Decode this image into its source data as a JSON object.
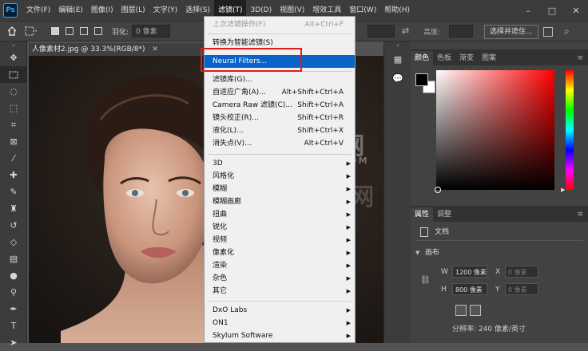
{
  "app": {
    "logo": "Ps"
  },
  "menubar": {
    "items": [
      "文件(F)",
      "编辑(E)",
      "图像(I)",
      "图层(L)",
      "文字(Y)",
      "选择(S)",
      "滤镜(T)",
      "3D(D)",
      "视图(V)",
      "增效工具",
      "窗口(W)",
      "帮助(H)"
    ],
    "active_index": 6,
    "controls": {
      "minimize": "–",
      "maximize": "□",
      "close": "✕"
    }
  },
  "options_bar": {
    "feather_label": "羽化:",
    "feather_value": "0 像素",
    "height_label": "高度:",
    "select_mask_button": "选择并遮住..."
  },
  "document": {
    "tab_title": "人像素材2.jpg @ 33.3%(RGB/8*)"
  },
  "watermarks": {
    "text1": "TZ素材网",
    "text2": "TZSUCAI.COM"
  },
  "filter_menu": {
    "last_filter": {
      "label": "上次滤镜操作(F)",
      "shortcut": "Alt+Ctrl+F"
    },
    "smart_filter": "转换为智能滤镜(S)",
    "neural_filters": "Neural Filters...",
    "items": [
      {
        "label": "滤镜库(G)...",
        "shortcut": ""
      },
      {
        "label": "自适应广角(A)...",
        "shortcut": "Alt+Shift+Ctrl+A"
      },
      {
        "label": "Camera Raw 滤镜(C)...",
        "shortcut": "Shift+Ctrl+A"
      },
      {
        "label": "镜头校正(R)...",
        "shortcut": "Shift+Ctrl+R"
      },
      {
        "label": "液化(L)...",
        "shortcut": "Shift+Ctrl+X"
      },
      {
        "label": "消失点(V)...",
        "shortcut": "Alt+Ctrl+V"
      }
    ],
    "submenus": [
      "3D",
      "风格化",
      "模糊",
      "模糊画廊",
      "扭曲",
      "锐化",
      "视频",
      "像素化",
      "渲染",
      "杂色",
      "其它"
    ],
    "plugins": [
      "DxO Labs",
      "ON1",
      "Skylum Software"
    ]
  },
  "color_panel": {
    "tabs": [
      "颜色",
      "色板",
      "渐变",
      "图案"
    ],
    "foreground": "#000000",
    "background": "#ffffff",
    "hue": "#ff0000"
  },
  "properties_panel": {
    "tabs": [
      "属性",
      "调整"
    ],
    "doc_label": "文档",
    "canvas_section": "画布",
    "w_label": "W",
    "w_value": "1200 像素",
    "h_label": "H",
    "h_value": "800 像素",
    "x_label": "X",
    "x_placeholder": "0 像素",
    "y_label": "Y",
    "y_placeholder": "0 像素",
    "resolution": "分辨率: 240 像素/英寸"
  },
  "colors": {
    "highlight": "#0a64c8",
    "callout_border": "#e21b1b"
  }
}
